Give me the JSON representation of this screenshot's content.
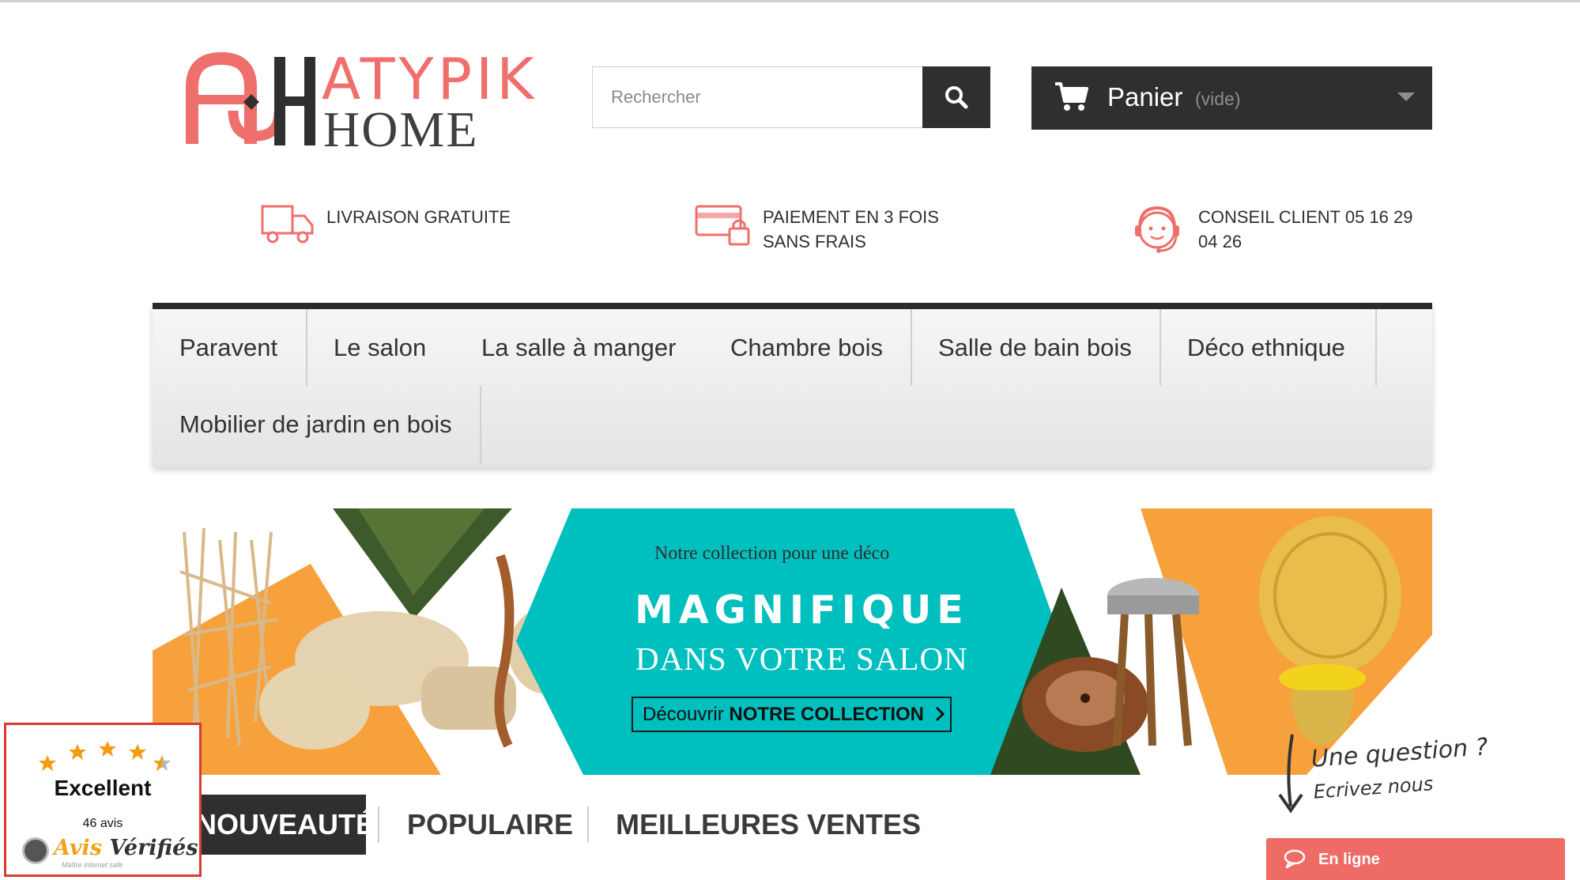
{
  "header": {
    "logo": {
      "line1": "ATYPIK",
      "line2": "HOME"
    },
    "search": {
      "placeholder": "Rechercher"
    },
    "search_button_icon": "search-icon",
    "cart": {
      "label": "Panier",
      "state": "(vide)",
      "icon": "cart-icon"
    }
  },
  "reassurance": [
    {
      "icon": "delivery-truck-icon",
      "text": "LIVRAISON GRATUITE"
    },
    {
      "icon": "credit-card-lock-icon",
      "line1": "PAIEMENT EN 3 FOIS",
      "line2": "SANS FRAIS"
    },
    {
      "icon": "customer-support-icon",
      "line1": "CONSEIL CLIENT 05 16 29",
      "line2": "04 26"
    }
  ],
  "menu": {
    "items": [
      "Paravent",
      "Le salon",
      "La salle à manger",
      "Chambre bois",
      "Salle de bain bois",
      "Déco ethnique",
      "Mobilier de jardin en bois"
    ]
  },
  "banner": {
    "subtitle": "Notre collection pour une déco",
    "title": "MAGNIFIQUE",
    "title2": "DANS VOTRE SALON",
    "cta_prefix": "Découvrir ",
    "cta_bold": "NOTRE COLLECTION",
    "colors": {
      "teal": "#00bfbf",
      "orange": "#f7a13c"
    }
  },
  "tabs": {
    "active": "NOUVEAUTÉS",
    "items": [
      "POPULAIRE",
      "MEILLEURES VENTES"
    ]
  },
  "reviews": {
    "rating_label": "Excellent",
    "count": "46 avis",
    "brand_part1": "Avis",
    "brand_part2": "Vérifiés",
    "tagline": "Maître internet safe",
    "stars": 4.5
  },
  "question": {
    "line1": "Une question ?",
    "line2": "Ecrivez nous"
  },
  "chat": {
    "label": "En ligne",
    "icon": "chat-bubble-icon"
  },
  "colors": {
    "brand": "#ef6f6c",
    "dark": "#2f2f2f",
    "accent": "#ef6b66"
  }
}
